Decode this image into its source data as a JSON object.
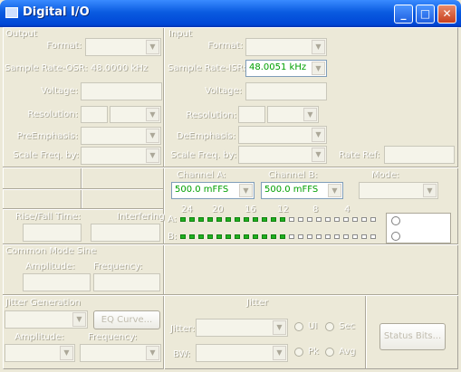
{
  "window": {
    "title": "Digital I/O",
    "minimize": "_",
    "maximize": "□",
    "close": "✕"
  },
  "output": {
    "group": "Output",
    "format_label": "Format:",
    "sample_rate_text": "Sample Rate-OSR: 48.0000 kHz",
    "voltage_label": "Voltage:",
    "resolution_label": "Resolution:",
    "preemphasis_label": "PreEmphasis:",
    "scale_freq_label": "Scale Freq. by:"
  },
  "input": {
    "group": "Input",
    "format_label": "Format:",
    "sample_rate_label": "Sample Rate-ISR:",
    "sample_rate_value": "48.0051 kHz",
    "voltage_label": "Voltage:",
    "resolution_label": "Resolution:",
    "deemphasis_label": "DeEmphasis:",
    "scale_freq_label": "Scale Freq. by:",
    "rate_ref_label": "Rate Ref:"
  },
  "timing": {
    "rise_fall_label": "Rise/Fall Time:",
    "interfering_label": "Interfering"
  },
  "meter": {
    "channel_a_label": "Channel A:",
    "channel_a_value": "500.0  mFFS",
    "channel_b_label": "Channel B:",
    "channel_b_value": "500.0  mFFS",
    "mode_label": "Mode:",
    "scale": [
      "24",
      "20",
      "16",
      "12",
      "8",
      "4"
    ],
    "row_a_label": "A:",
    "row_b_label": "B:",
    "led_lit_count": 12,
    "led_total": 22
  },
  "common_mode": {
    "group": "Common Mode Sine",
    "amplitude_label": "Amplitude:",
    "frequency_label": "Frequency:"
  },
  "jitter_gen": {
    "group": "Jitter Generation",
    "eq_curve_button": "EQ Curve...",
    "amplitude_label": "Amplitude:",
    "frequency_label": "Frequency:"
  },
  "jitter": {
    "group": "Jitter",
    "jitter_label": "Jitter:",
    "bw_label": "BW:",
    "ui_label": "UI",
    "sec_label": "Sec",
    "pk_label": "Pk",
    "avg_label": "Avg",
    "status_bits_button": "Status Bits..."
  }
}
